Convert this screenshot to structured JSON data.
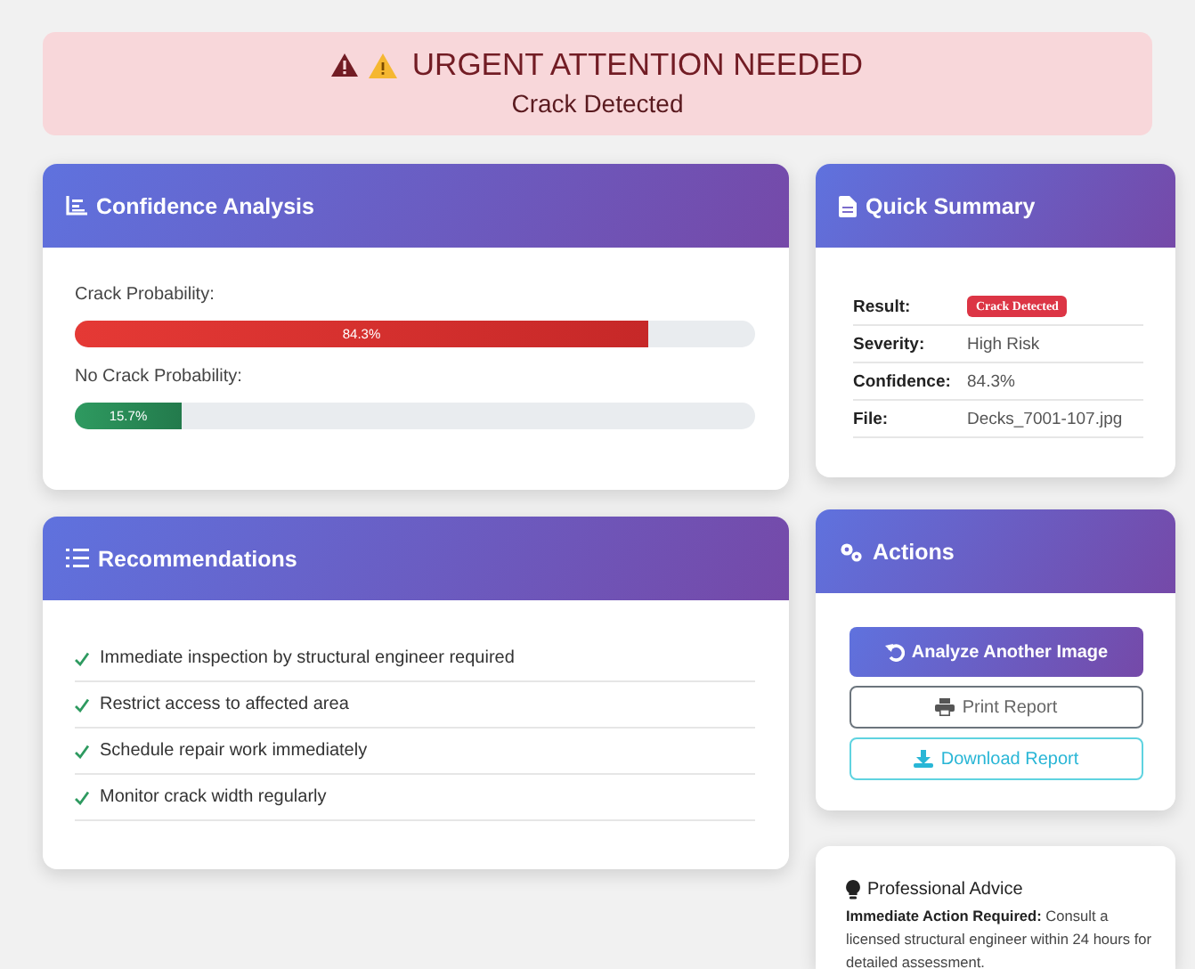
{
  "alert": {
    "title": "URGENT ATTENTION NEEDED",
    "subtitle": "Crack Detected"
  },
  "confidence_analysis": {
    "title": "Confidence Analysis",
    "bars": [
      {
        "label": "Crack Probability:",
        "reading": "84.3%",
        "level": 0.843,
        "kind": "danger"
      },
      {
        "label": "No Crack Probability:",
        "reading": "15.7%",
        "level": 0.157,
        "kind": "safe"
      }
    ]
  },
  "quick_summary": {
    "title": "Quick Summary",
    "rows": [
      {
        "label": "Result:",
        "value": "Crack Detected",
        "kind": "badge"
      },
      {
        "label": "Severity:",
        "value": "High Risk",
        "kind": "text"
      },
      {
        "label": "Confidence:",
        "value": "84.3%",
        "kind": "text"
      },
      {
        "label": "File:",
        "value": "Decks_7001-107.jpg",
        "kind": "text"
      }
    ]
  },
  "recommendations": {
    "title": "Recommendations",
    "items": [
      "Immediate inspection by structural engineer required",
      "Restrict access to affected area",
      "Schedule repair work immediately",
      "Monitor crack width regularly"
    ]
  },
  "actions": {
    "title": "Actions",
    "buttons": [
      {
        "label": "Analyze Another Image",
        "kind": "primary"
      },
      {
        "label": "Print Report",
        "kind": "outline"
      },
      {
        "label": "Download Report",
        "kind": "info"
      }
    ]
  },
  "professional_advice": {
    "title": "Professional Advice",
    "text": "**Immediate Action Required:** Consult a licensed structural engineer within 24 hours for detailed assessment."
  }
}
